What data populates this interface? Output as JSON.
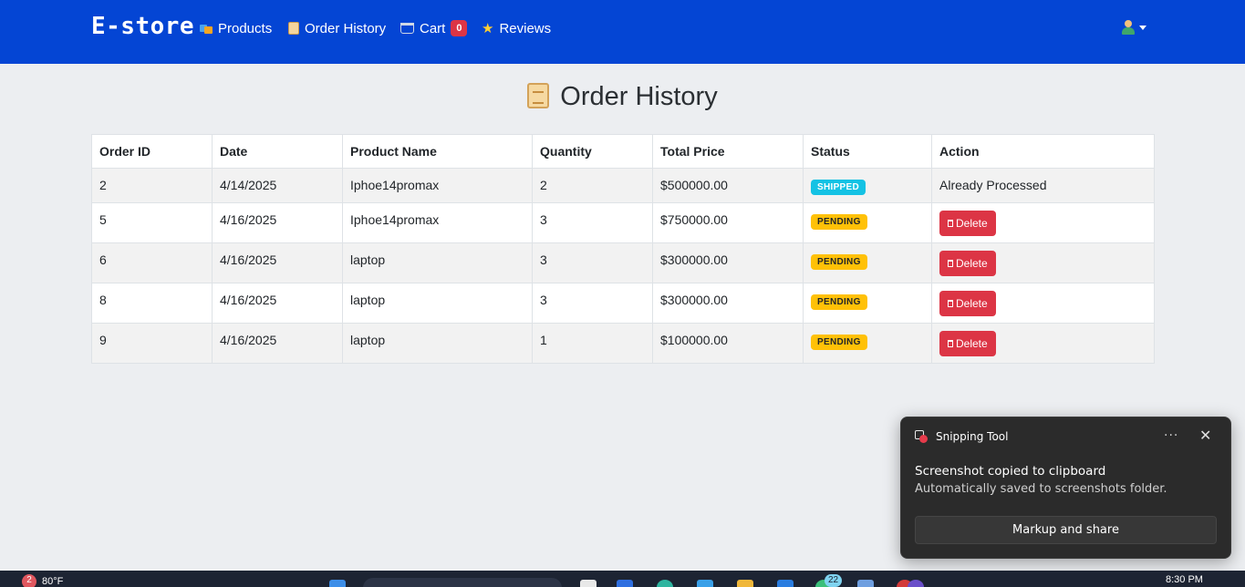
{
  "navbar": {
    "brand": "E-store",
    "items": [
      {
        "label": "Products",
        "icon": "products-icon"
      },
      {
        "label": "Order History",
        "icon": "scroll-icon"
      },
      {
        "label": "Cart",
        "icon": "cart-icon",
        "badge": "0"
      },
      {
        "label": "Reviews",
        "icon": "star-icon"
      }
    ],
    "user_icon": "user-icon"
  },
  "page": {
    "title": "Order History",
    "title_icon": "scroll-icon"
  },
  "table": {
    "headers": [
      "Order ID",
      "Date",
      "Product Name",
      "Quantity",
      "Total Price",
      "Status",
      "Action"
    ],
    "rows": [
      {
        "id": "2",
        "date": "4/14/2025",
        "product": "Iphoe14promax",
        "qty": "2",
        "total": "$500000.00",
        "status": "SHIPPED",
        "action": "Already Processed"
      },
      {
        "id": "5",
        "date": "4/16/2025",
        "product": "Iphoe14promax",
        "qty": "3",
        "total": "$750000.00",
        "status": "PENDING",
        "action": "Delete"
      },
      {
        "id": "6",
        "date": "4/16/2025",
        "product": "laptop",
        "qty": "3",
        "total": "$300000.00",
        "status": "PENDING",
        "action": "Delete"
      },
      {
        "id": "8",
        "date": "4/16/2025",
        "product": "laptop",
        "qty": "3",
        "total": "$300000.00",
        "status": "PENDING",
        "action": "Delete"
      },
      {
        "id": "9",
        "date": "4/16/2025",
        "product": "laptop",
        "qty": "1",
        "total": "$100000.00",
        "status": "PENDING",
        "action": "Delete"
      }
    ]
  },
  "toast": {
    "app_name": "Snipping Tool",
    "title": "Screenshot copied to clipboard",
    "text": "Automatically saved to screenshots folder.",
    "button": "Markup and share",
    "more": "···",
    "close": "✕"
  },
  "taskbar": {
    "weather_badge": "2",
    "temperature": "80°F",
    "notification_count": "22",
    "time": "8:30 PM"
  },
  "colors": {
    "navbar": "#0445d4",
    "danger": "#dc3545",
    "shipped": "#14c2e4",
    "pending": "#ffc107"
  }
}
